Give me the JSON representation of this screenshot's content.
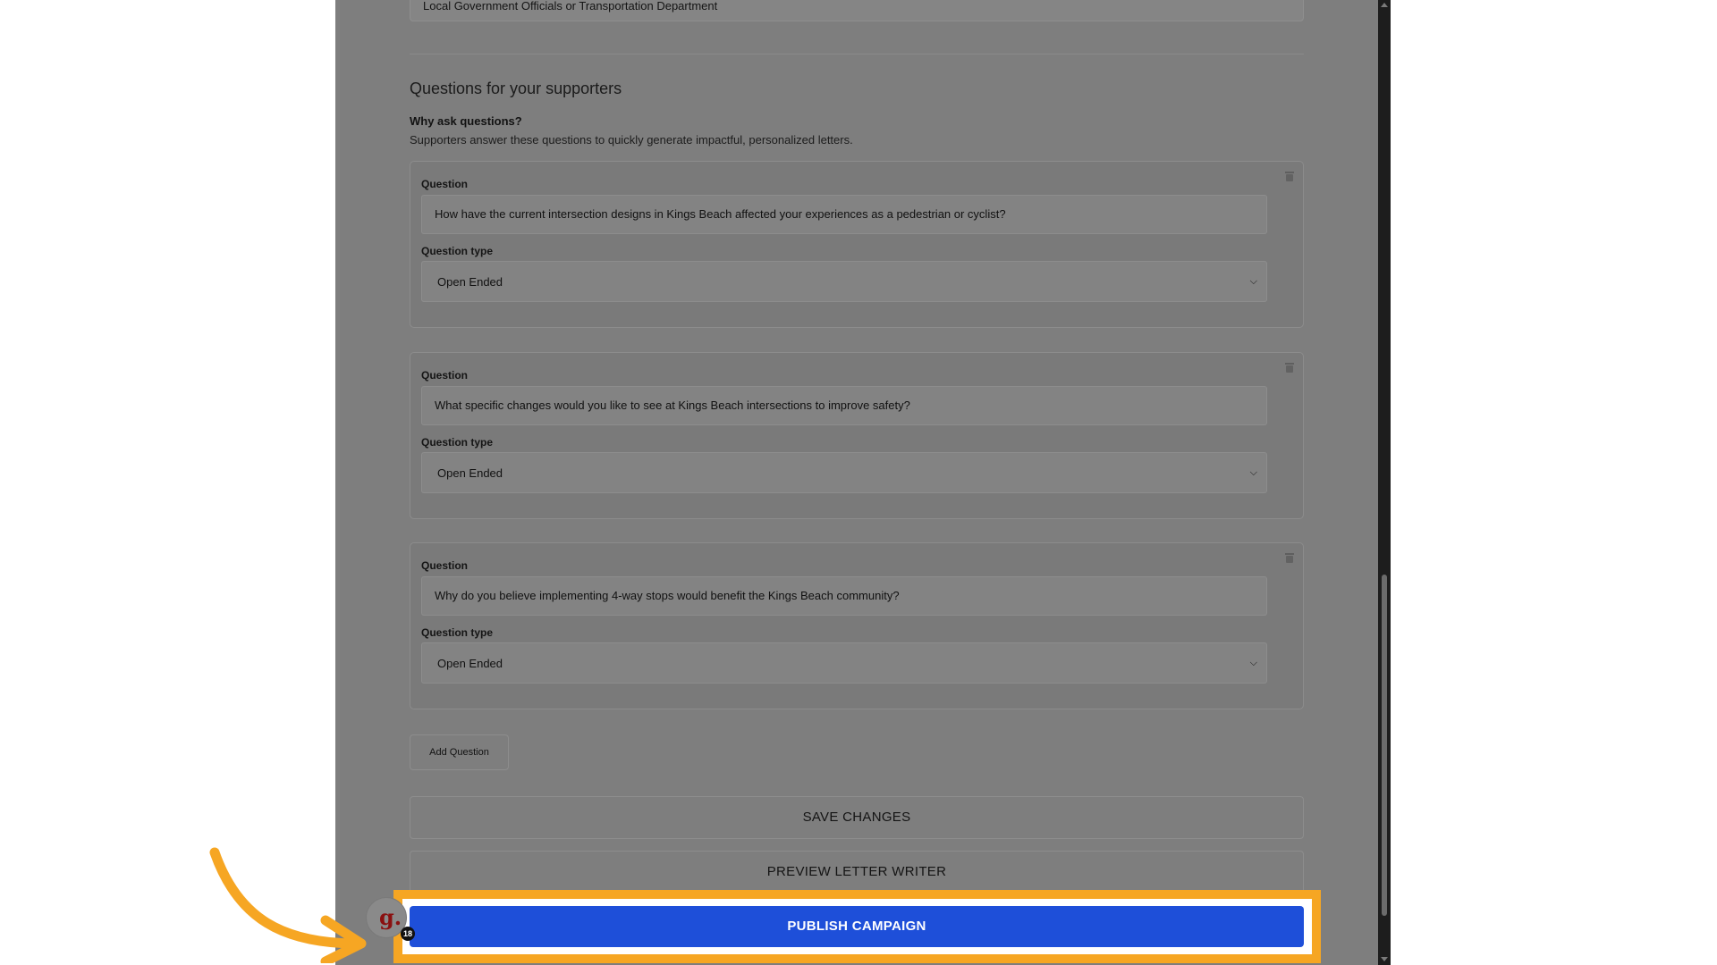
{
  "previous_field": {
    "value": "Local Government Officials or Transportation Department"
  },
  "questions_section": {
    "title": "Questions for your supporters",
    "why_title": "Why ask questions?",
    "why_description": "Supporters answer these questions to quickly generate impactful, personalized letters."
  },
  "questions": [
    {
      "question_label": "Question",
      "question_value": "How have the current intersection designs in Kings Beach affected your experiences as a pedestrian or cyclist?",
      "type_label": "Question type",
      "type_value": "Open Ended"
    },
    {
      "question_label": "Question",
      "question_value": "What specific changes would you like to see at Kings Beach intersections to improve safety?",
      "type_label": "Question type",
      "type_value": "Open Ended"
    },
    {
      "question_label": "Question",
      "question_value": "Why do you believe implementing 4-way stops would benefit the Kings Beach community?",
      "type_label": "Question type",
      "type_value": "Open Ended"
    }
  ],
  "buttons": {
    "add_question": "Add Question",
    "save_changes": "SAVE CHANGES",
    "preview_letter_writer": "PREVIEW LETTER WRITER",
    "publish_campaign": "PUBLISH CAMPAIGN"
  },
  "avatar": {
    "glyph": "g.",
    "badge_count": "18"
  },
  "colors": {
    "highlight": "#f6a623",
    "publish_button": "#1e4fd9",
    "overlay": "#7e7e7e"
  },
  "icons": {
    "delete": "trash-icon",
    "select": "chevron-down-icon",
    "pointer": "curved-arrow-icon"
  }
}
